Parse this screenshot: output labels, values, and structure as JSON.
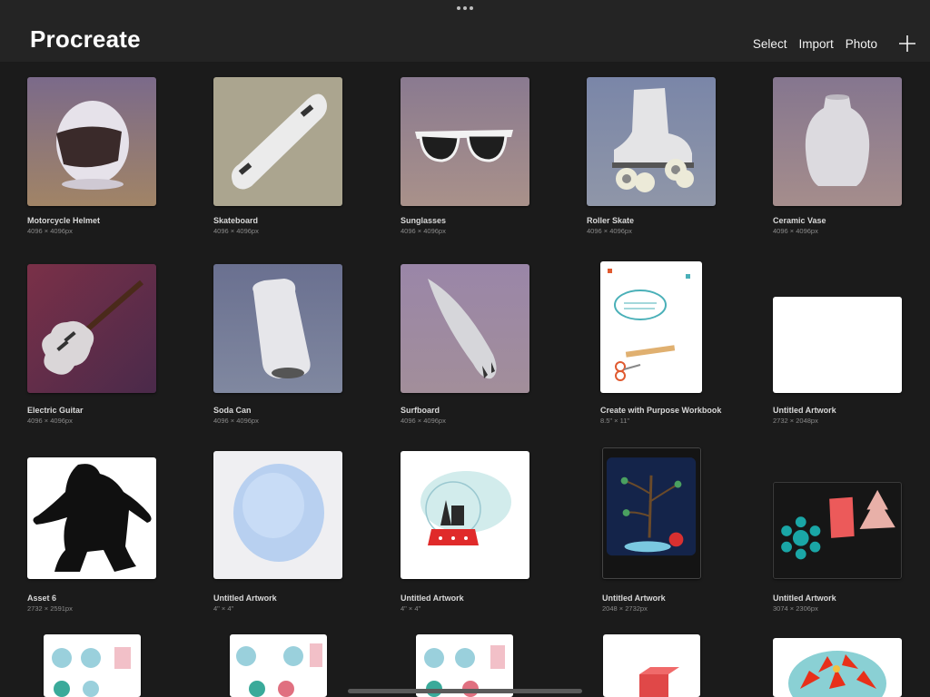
{
  "header": {
    "title": "Procreate",
    "actions": {
      "select": "Select",
      "import": "Import",
      "photo": "Photo"
    }
  },
  "icons": {
    "add": "plus-icon",
    "more": "more-dots-icon"
  },
  "colors": {
    "background": "#1b1b1b",
    "topbar": "#242424",
    "text": "#ffffff",
    "subtext": "#8a8a8a"
  },
  "artworks": [
    {
      "name": "Motorcycle Helmet",
      "size": "4096 × 4096px"
    },
    {
      "name": "Skateboard",
      "size": "4096 × 4096px"
    },
    {
      "name": "Sunglasses",
      "size": "4096 × 4096px"
    },
    {
      "name": "Roller Skate",
      "size": "4096 × 4096px"
    },
    {
      "name": "Ceramic Vase",
      "size": "4096 × 4096px"
    },
    {
      "name": "Electric Guitar",
      "size": "4096 × 4096px"
    },
    {
      "name": "Soda Can",
      "size": "4096 × 4096px"
    },
    {
      "name": "Surfboard",
      "size": "4096 × 4096px"
    },
    {
      "name": "Create with Purpose Workbook",
      "size": "8.5\" × 11\""
    },
    {
      "name": "Untitled Artwork",
      "size": "2732 × 2048px"
    },
    {
      "name": "Asset 6",
      "size": "2732 × 2591px"
    },
    {
      "name": "Untitled Artwork",
      "size": "4\" × 4\""
    },
    {
      "name": "Untitled Artwork",
      "size": "4\" × 4\""
    },
    {
      "name": "Untitled Artwork",
      "size": "2048 × 2732px"
    },
    {
      "name": "Untitled Artwork",
      "size": "3074 × 2306px"
    }
  ]
}
